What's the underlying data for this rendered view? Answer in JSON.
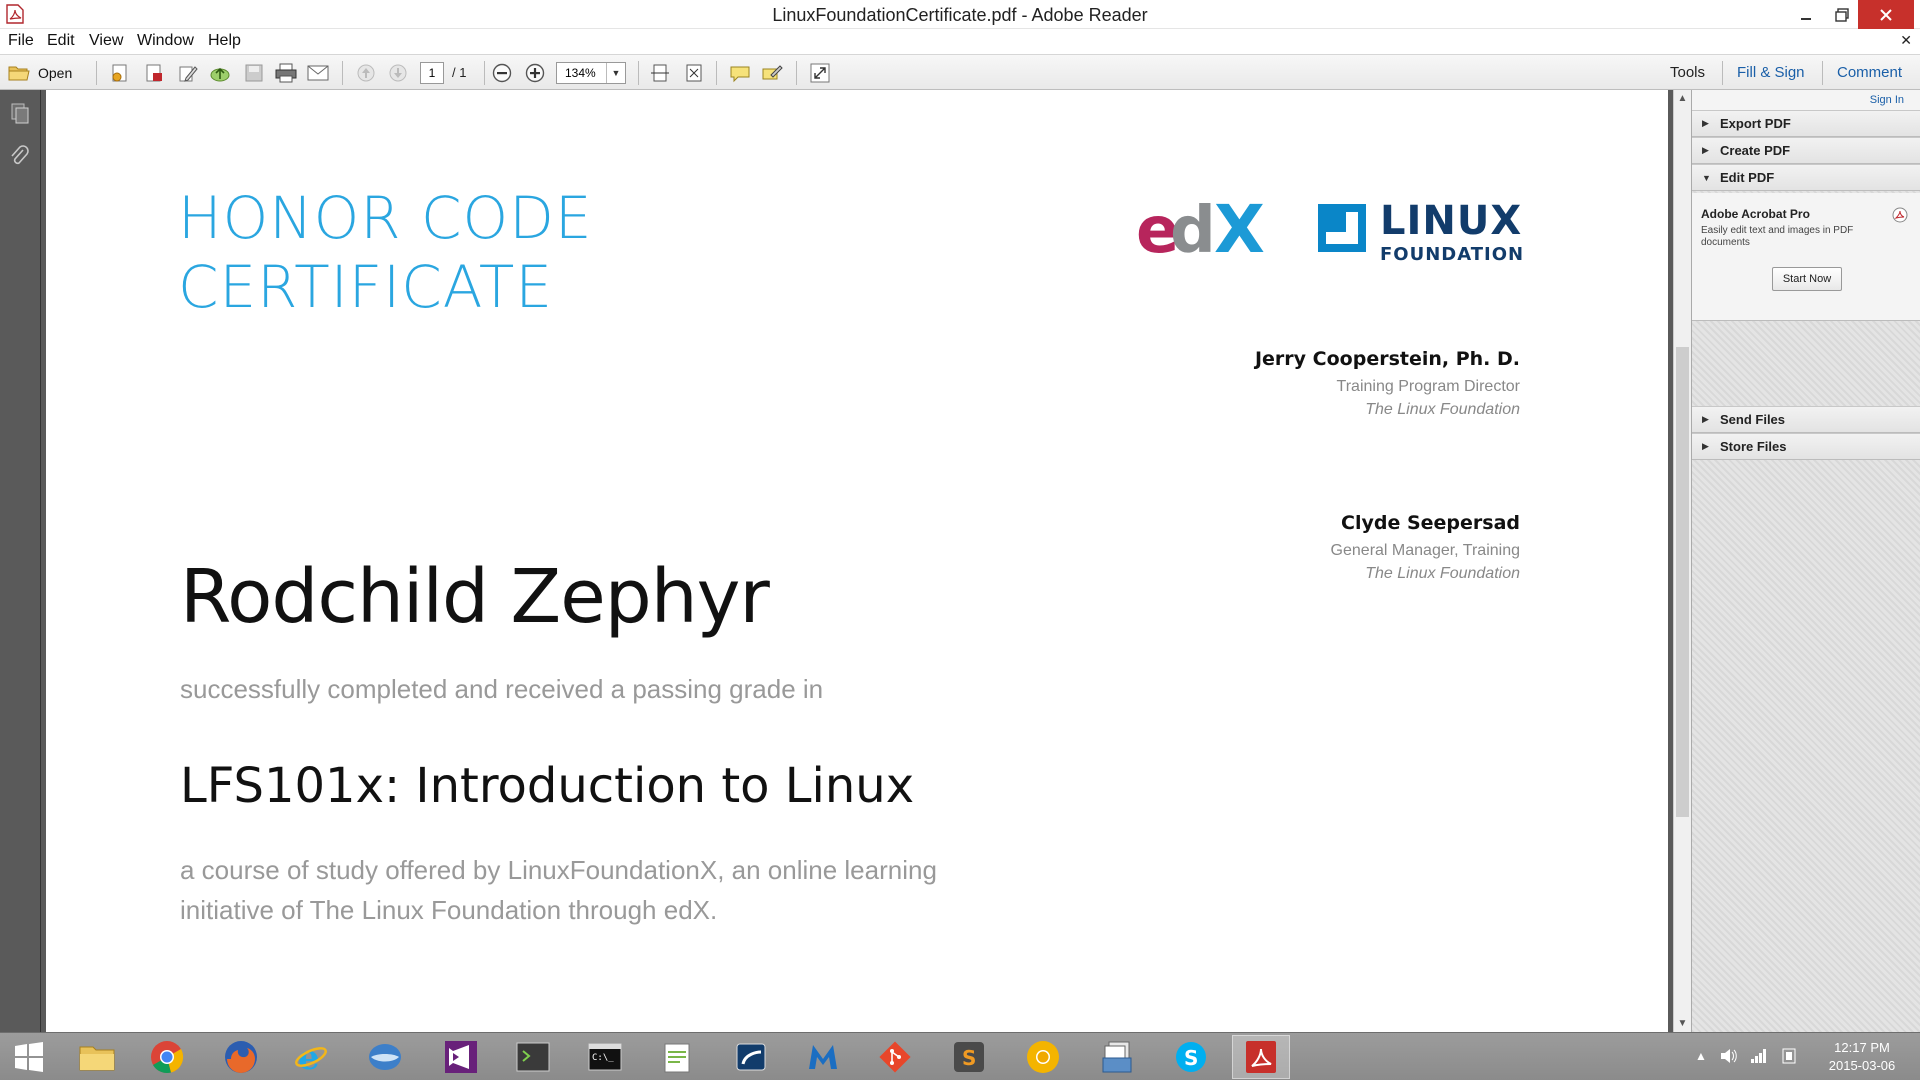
{
  "window": {
    "title": "LinuxFoundationCertificate.pdf - Adobe Reader"
  },
  "menu": {
    "items": [
      "File",
      "Edit",
      "View",
      "Window",
      "Help"
    ]
  },
  "toolbar": {
    "open_label": "Open",
    "page_current": "1",
    "page_total": "/ 1",
    "zoom": "134%",
    "tools_label": "Tools",
    "fill_sign_label": "Fill & Sign",
    "comment_label": "Comment"
  },
  "certificate": {
    "title_line1": "HONOR CODE",
    "title_line2": "CERTIFICATE",
    "recipient": "Rodchild Zephyr",
    "completed_text": "successfully completed and received a passing grade in",
    "course": "LFS101x: Introduction to Linux",
    "offered_line1": "a course of study offered by LinuxFoundationX, an online learning",
    "offered_line2": "initiative of The Linux Foundation through edX.",
    "signatories": [
      {
        "name": "Jerry Cooperstein, Ph. D.",
        "role": "Training Program Director",
        "org": "The Linux Foundation"
      },
      {
        "name": "Clyde Seepersad",
        "role": "General Manager, Training",
        "org": "The Linux Foundation"
      }
    ],
    "logos": {
      "edx": "edX",
      "linux": "LINUX",
      "foundation": "FOUNDATION"
    }
  },
  "right_pane": {
    "sign_in": "Sign In",
    "sections": [
      "Export PDF",
      "Create PDF",
      "Edit PDF",
      "Send Files",
      "Store Files"
    ],
    "edit_pdf": {
      "title": "Adobe Acrobat Pro",
      "description": "Easily edit text and images in PDF documents",
      "button": "Start Now"
    }
  },
  "taskbar": {
    "time": "12:17 PM",
    "date": "2015-03-06"
  },
  "colors": {
    "accent_blue": "#2aa6e0",
    "edx_magenta": "#b7255c",
    "edx_gray": "#8a8d8f",
    "linux_navy": "#123c6b",
    "link_blue": "#1a5fa8"
  }
}
